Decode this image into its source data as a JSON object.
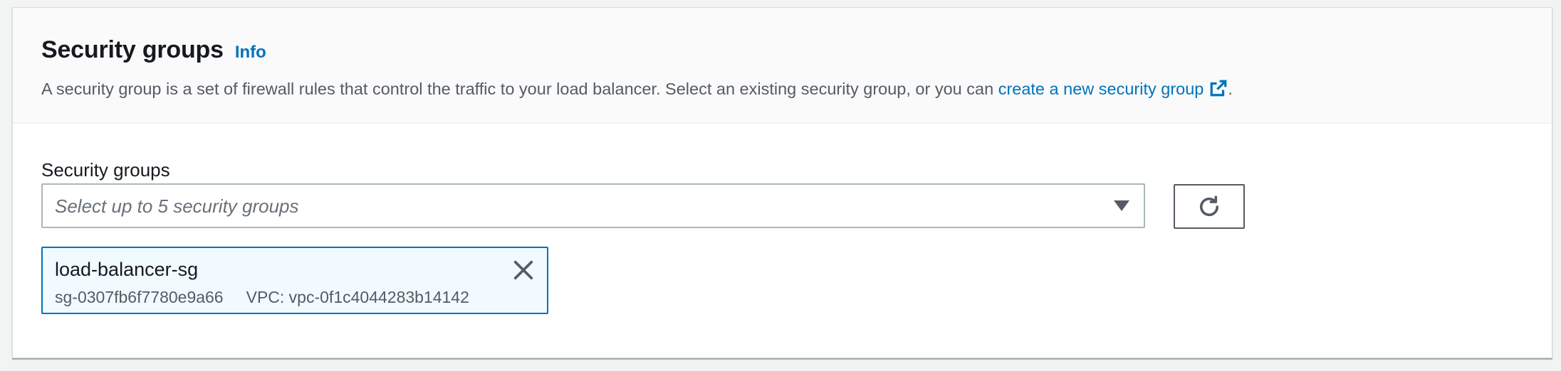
{
  "header": {
    "title": "Security groups",
    "info_label": "Info",
    "description": "A security group is a set of firewall rules that control the traffic to your load balancer. Select an existing security group, or you can ",
    "description_link": "create a new security group",
    "description_end": ".",
    "external_icon": "external-link-icon"
  },
  "field": {
    "label": "Security groups",
    "placeholder": "Select up to 5 security groups",
    "dropdown_icon": "caret-down-icon",
    "refresh_icon": "refresh-icon",
    "max_selections": 5
  },
  "selected_groups": [
    {
      "name": "load-balancer-sg",
      "id": "sg-0307fb6f7780e9a66",
      "vpc": "VPC: vpc-0f1c4044283b14142",
      "dismiss_icon": "close-icon"
    }
  ],
  "colors": {
    "link": "#0073bb",
    "token_bg": "#f1faff",
    "token_border": "#0073bb",
    "text_primary": "#16191f",
    "text_secondary": "#545b64",
    "placeholder": "#687078",
    "page_bg": "#f2f3f3"
  }
}
